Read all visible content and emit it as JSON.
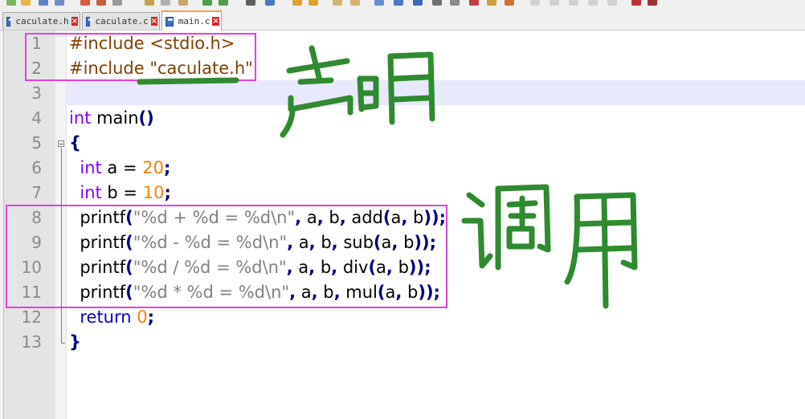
{
  "tabs": [
    {
      "label": "caculate.h",
      "active": false
    },
    {
      "label": "caculate.c",
      "active": false
    },
    {
      "label": "main.c",
      "active": true
    }
  ],
  "code_lines": [
    {
      "n": "1",
      "parts": [
        [
          "pre",
          "#include <stdio.h>"
        ]
      ]
    },
    {
      "n": "2",
      "parts": [
        [
          "pre",
          "#include \"caculate.h\""
        ]
      ]
    },
    {
      "n": "3",
      "parts": []
    },
    {
      "n": "4",
      "parts": [
        [
          "kw",
          "int"
        ],
        [
          "",
          " main"
        ],
        [
          "punc",
          "()"
        ]
      ]
    },
    {
      "n": "5",
      "parts": [
        [
          "punc",
          "{"
        ]
      ]
    },
    {
      "n": "6",
      "parts": [
        [
          "",
          "  "
        ],
        [
          "kw",
          "int"
        ],
        [
          "",
          " a = "
        ],
        [
          "num",
          "20"
        ],
        [
          "punc",
          ";"
        ]
      ]
    },
    {
      "n": "7",
      "parts": [
        [
          "",
          "  "
        ],
        [
          "kw",
          "int"
        ],
        [
          "",
          " b = "
        ],
        [
          "num",
          "10"
        ],
        [
          "punc",
          ";"
        ]
      ]
    },
    {
      "n": "8",
      "parts": [
        [
          "",
          "  printf"
        ],
        [
          "punc",
          "("
        ],
        [
          "str",
          "\"%d + %d = %d\\n\""
        ],
        [
          "punc",
          ","
        ],
        [
          "",
          " a"
        ],
        [
          "punc",
          ","
        ],
        [
          "",
          " b"
        ],
        [
          "punc",
          ","
        ],
        [
          "",
          " add"
        ],
        [
          "punc",
          "("
        ],
        [
          "",
          "a"
        ],
        [
          "punc",
          ","
        ],
        [
          "",
          " b"
        ],
        [
          "punc",
          "));"
        ]
      ]
    },
    {
      "n": "9",
      "parts": [
        [
          "",
          "  printf"
        ],
        [
          "punc",
          "("
        ],
        [
          "str",
          "\"%d - %d = %d\\n\""
        ],
        [
          "punc",
          ","
        ],
        [
          "",
          " a"
        ],
        [
          "punc",
          ","
        ],
        [
          "",
          " b"
        ],
        [
          "punc",
          ","
        ],
        [
          "",
          " sub"
        ],
        [
          "punc",
          "("
        ],
        [
          "",
          "a"
        ],
        [
          "punc",
          ","
        ],
        [
          "",
          " b"
        ],
        [
          "punc",
          "));"
        ]
      ]
    },
    {
      "n": "10",
      "parts": [
        [
          "",
          "  printf"
        ],
        [
          "punc",
          "("
        ],
        [
          "str",
          "\"%d / %d = %d\\n\""
        ],
        [
          "punc",
          ","
        ],
        [
          "",
          " a"
        ],
        [
          "punc",
          ","
        ],
        [
          "",
          " b"
        ],
        [
          "punc",
          ","
        ],
        [
          "",
          " div"
        ],
        [
          "punc",
          "("
        ],
        [
          "",
          "a"
        ],
        [
          "punc",
          ","
        ],
        [
          "",
          " b"
        ],
        [
          "punc",
          "));"
        ]
      ]
    },
    {
      "n": "11",
      "parts": [
        [
          "",
          "  printf"
        ],
        [
          "punc",
          "("
        ],
        [
          "str",
          "\"%d * %d = %d\\n\""
        ],
        [
          "punc",
          ","
        ],
        [
          "",
          " a"
        ],
        [
          "punc",
          ","
        ],
        [
          "",
          " b"
        ],
        [
          "punc",
          ","
        ],
        [
          "",
          " mul"
        ],
        [
          "punc",
          "("
        ],
        [
          "",
          "a"
        ],
        [
          "punc",
          ","
        ],
        [
          "",
          " b"
        ],
        [
          "punc",
          "));"
        ]
      ]
    },
    {
      "n": "12",
      "parts": [
        [
          "",
          "  "
        ],
        [
          "ret",
          "return"
        ],
        [
          "",
          " "
        ],
        [
          "num",
          "0"
        ],
        [
          "punc",
          ";"
        ]
      ]
    },
    {
      "n": "13",
      "parts": [
        [
          "punc",
          "}"
        ]
      ]
    }
  ],
  "annotations": {
    "declaration_label": "声明",
    "call_label": "调用"
  },
  "colors": {
    "keyword": "#8000ff",
    "number": "#ff8000",
    "string": "#808080",
    "preprocessor": "#804000",
    "annotation_box": "#e040e0",
    "handwriting": "#2e8b2e"
  }
}
